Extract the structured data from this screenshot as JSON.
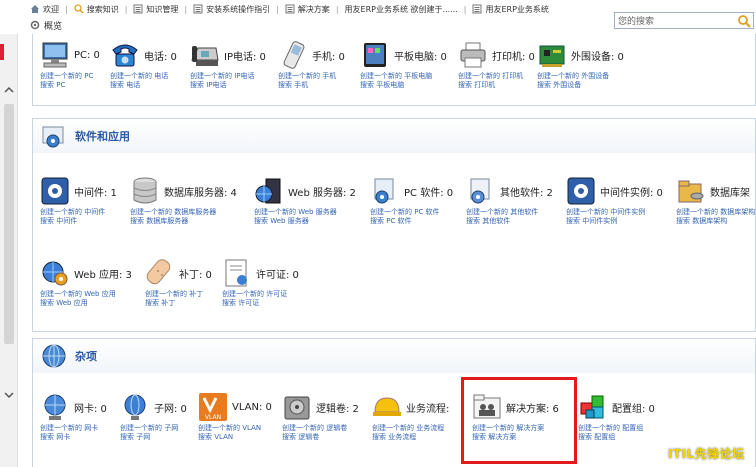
{
  "tabs": [
    {
      "label": "欢迎",
      "icon": "home-icon"
    },
    {
      "label": "搜索知识",
      "icon": "search-icon"
    },
    {
      "label": "知识管理",
      "icon": "document-icon"
    },
    {
      "label": "安装系统操作指引",
      "icon": "document-icon"
    },
    {
      "label": "解决方案",
      "icon": "document-icon"
    },
    {
      "label": "用友ERP业务系统 欲创建于......",
      "icon": "document-icon"
    },
    {
      "label": "用友ERP业务系统",
      "icon": "document-icon"
    }
  ],
  "search": {
    "placeholder": "您的搜索"
  },
  "overview": {
    "label": "概览"
  },
  "hardware": {
    "items": [
      {
        "name": "PC: 0",
        "link1": "创建一个新的 PC",
        "link2": "搜索 PC",
        "icon": "pc-icon"
      },
      {
        "name": "电话: 0",
        "link1": "创建一个新的 电话",
        "link2": "搜索 电话",
        "icon": "telephone-icon"
      },
      {
        "name": "IP电话: 0",
        "link1": "创建一个新的 IP电话",
        "link2": "搜索 IP电话",
        "icon": "ip-phone-icon"
      },
      {
        "name": "手机: 0",
        "link1": "创建一个新的 手机",
        "link2": "搜索 手机",
        "icon": "mobile-phone-icon"
      },
      {
        "name": "平板电脑: 0",
        "link1": "创建一个新的 平板电脑",
        "link2": "搜索 平板电脑",
        "icon": "tablet-icon"
      },
      {
        "name": "打印机: 0",
        "link1": "创建一个新的 打印机",
        "link2": "搜索 打印机",
        "icon": "printer-icon"
      },
      {
        "name": "外围设备: 0",
        "link1": "创建一个新的 外围设备",
        "link2": "搜索 外围设备",
        "icon": "peripheral-icon"
      }
    ]
  },
  "software": {
    "title": "软件和应用",
    "items": [
      {
        "name": "中间件: 1",
        "link1": "创建一个新的 中间件",
        "link2": "搜索 中间件",
        "icon": "middleware-icon"
      },
      {
        "name": "数据库服务器: 4",
        "link1": "创建一个新的 数据库服务器",
        "link2": "搜索 数据库服务器",
        "icon": "database-server-icon"
      },
      {
        "name": "Web 服务器: 2",
        "link1": "创建一个新的 Web 服务器",
        "link2": "搜索 Web 服务器",
        "icon": "web-server-icon"
      },
      {
        "name": "PC 软件: 0",
        "link1": "创建一个新的 PC 软件",
        "link2": "搜索 PC 软件",
        "icon": "pc-software-icon"
      },
      {
        "name": "其他软件: 2",
        "link1": "创建一个新的 其他软件",
        "link2": "搜索 其他软件",
        "icon": "other-software-icon"
      },
      {
        "name": "中间件实例: 0",
        "link1": "创建一个新的 中间件实例",
        "link2": "搜索 中间件实例",
        "icon": "middleware-instance-icon"
      },
      {
        "name": "数据库架",
        "link1": "创建一个新的 数据库架构",
        "link2": "搜索 数据库架构",
        "icon": "database-schema-icon"
      },
      {
        "name": "Web 应用: 3",
        "link1": "创建一个新的 Web 应用",
        "link2": "搜索 Web 应用",
        "icon": "web-application-icon"
      },
      {
        "name": "补丁: 0",
        "link1": "创建一个新的 补丁",
        "link2": "搜索 补丁",
        "icon": "patch-icon"
      },
      {
        "name": "许可证: 0",
        "link1": "创建一个新的 许可证",
        "link2": "搜索 许可证",
        "icon": "license-icon"
      }
    ]
  },
  "misc": {
    "title": "杂项",
    "items": [
      {
        "name": "网卡: 0",
        "link1": "创建一个新的 网卡",
        "link2": "搜索 网卡",
        "icon": "network-card-icon"
      },
      {
        "name": "子网: 0",
        "link1": "创建一个新的 子网",
        "link2": "搜索 子网",
        "icon": "subnet-icon"
      },
      {
        "name": "VLAN: 0",
        "link1": "创建一个新的 VLAN",
        "link2": "搜索 VLAN",
        "icon": "vlan-icon",
        "badge": "VLAN"
      },
      {
        "name": "逻辑卷: 2",
        "link1": "创建一个新的 逻辑卷",
        "link2": "搜索 逻辑卷",
        "icon": "logical-volume-icon"
      },
      {
        "name": "业务流程:",
        "link1": "创建一个新的 业务流程",
        "link2": "搜索 业务流程",
        "icon": "business-process-icon"
      },
      {
        "name": "解决方案: 6",
        "link1": "创建一个新的 解决方案",
        "link2": "搜索 解决方案",
        "icon": "solution-icon"
      },
      {
        "name": "配置组: 0",
        "link1": "创建一个新的 配置组",
        "link2": "搜索 配置组",
        "icon": "config-group-icon"
      }
    ]
  },
  "watermark": "ITIL先锋论坛",
  "colors": {
    "link": "#3465b4",
    "section_title": "#2a5aa6",
    "highlight": "#e01b1b"
  }
}
